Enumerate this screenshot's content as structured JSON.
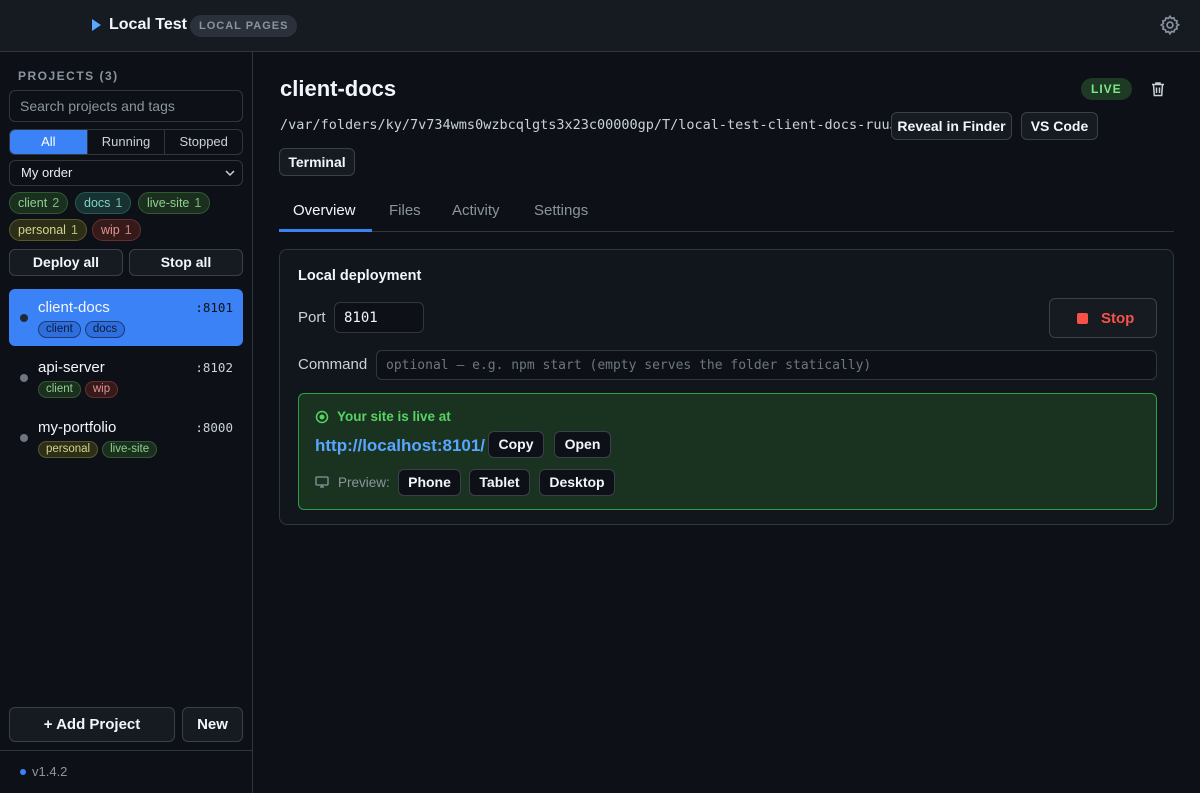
{
  "app": {
    "title": "Local Test",
    "badge": "LOCAL PAGES"
  },
  "icons": {
    "play": "play-icon",
    "settings": "gear-icon",
    "trash": "trash-icon",
    "live": "radio-dot-icon",
    "preview": "monitor-icon",
    "dropdown": "chevron-down-icon",
    "stop": "stop-square-icon"
  },
  "colors": {
    "accent": "#3b82f6",
    "live_green": "#56d364",
    "stop_red": "#f85149",
    "link": "#58a6ff"
  },
  "sidebar": {
    "heading": "PROJECTS (3)",
    "search_placeholder": "Search projects and tags",
    "filters": [
      "All",
      "Running",
      "Stopped"
    ],
    "active_filter": "All",
    "order_select": "My order",
    "tags": [
      {
        "name": "client",
        "count": "2"
      },
      {
        "name": "docs",
        "count": "1"
      },
      {
        "name": "live-site",
        "count": "1"
      },
      {
        "name": "personal",
        "count": "1"
      },
      {
        "name": "wip",
        "count": "1"
      }
    ],
    "deploy_all": "Deploy all",
    "stop_all": "Stop all",
    "projects": [
      {
        "name": "client-docs",
        "port": ":8101",
        "tags": [
          "client",
          "docs"
        ],
        "selected": true
      },
      {
        "name": "api-server",
        "port": ":8102",
        "tags": [
          "client",
          "wip"
        ],
        "selected": false
      },
      {
        "name": "my-portfolio",
        "port": ":8000",
        "tags": [
          "personal",
          "live-site"
        ],
        "selected": false
      }
    ],
    "add_project": "+ Add Project",
    "new": "New",
    "version": "v1.4.2"
  },
  "main": {
    "title": "client-docs",
    "status": "LIVE",
    "path": "/var/folders/ky/7v734wms0wzbcqlgts3x23c00000gp/T/local-test-client-docs-ruuJuC",
    "actions": {
      "reveal": "Reveal in Finder",
      "vscode": "VS Code",
      "terminal": "Terminal"
    },
    "tabs": [
      "Overview",
      "Files",
      "Activity",
      "Settings"
    ],
    "active_tab": "Overview",
    "deployment": {
      "title": "Local deployment",
      "port_label": "Port",
      "port_value": "8101",
      "stop": "Stop",
      "command_label": "Command",
      "command_placeholder": "optional — e.g. npm start (empty serves the folder statically)",
      "live_text": "Your site is live at",
      "url": "http://localhost:8101/",
      "copy": "Copy",
      "open": "Open",
      "preview_label": "Preview:",
      "preview_options": [
        "Phone",
        "Tablet",
        "Desktop"
      ]
    }
  }
}
